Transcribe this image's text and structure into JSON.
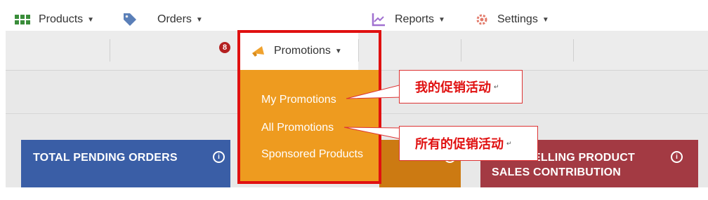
{
  "navbar": {
    "products_label": "Products",
    "orders_label": "Orders",
    "orders_badge": "8",
    "promotions_label": "Promotions",
    "reports_label": "Reports",
    "settings_label": "Settings"
  },
  "dropdown": {
    "items": [
      "My Promotions",
      "All Promotions",
      "Sponsored Products"
    ]
  },
  "panels": {
    "pending_title": "TOTAL PENDING ORDERS",
    "best_title_line1": "BEST SELLING PRODUCT",
    "best_title_line2": "SALES CONTRIBUTION"
  },
  "callouts": {
    "my_promotions": "我的促销活动",
    "all_promotions": "所有的促销活动",
    "mark": "↵"
  },
  "colors": {
    "dropdown": "#ee9b1f",
    "highlight": "#e01010",
    "panel_blue": "#3a5ea6",
    "panel_orange": "#cc7a12",
    "panel_red": "#a33a43"
  }
}
